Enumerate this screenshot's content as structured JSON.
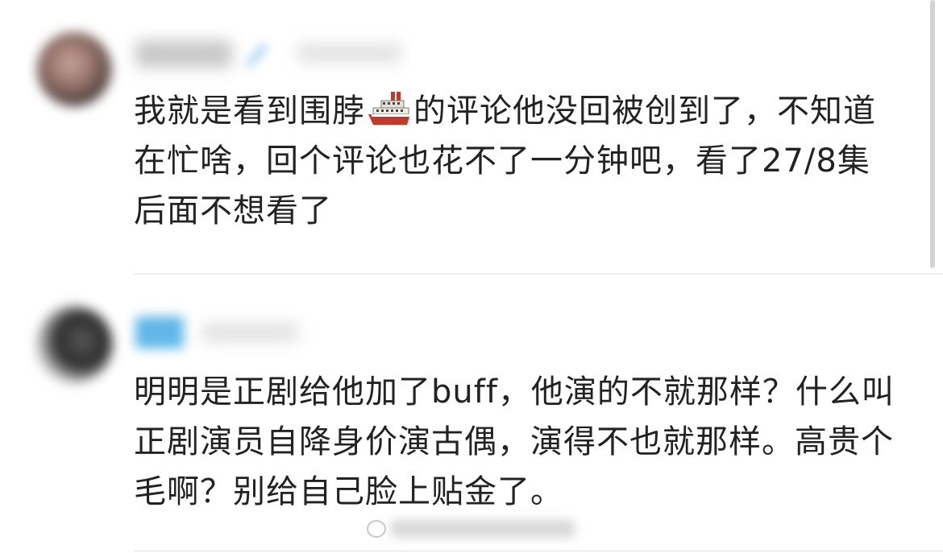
{
  "comments": [
    {
      "text_before_emoji": "我就是看到围脖",
      "emoji": "ship-icon",
      "text_after_emoji": "的评论他没回被创到了，不知道在忙啥，回个评论也花不了一分钟吧，看了27/8集后面不想看了"
    },
    {
      "text": "明明是正剧给他加了buff，他演的不就那样？什么叫正剧演员自降身价演古偶，演得不也就那样。高贵个毛啊？别给自己脸上贴金了。"
    }
  ],
  "colors": {
    "text": "#222222",
    "divider": "#e3e3e3",
    "verified_badge": "#4fb0e6",
    "ship_hull": "#c0392b"
  }
}
